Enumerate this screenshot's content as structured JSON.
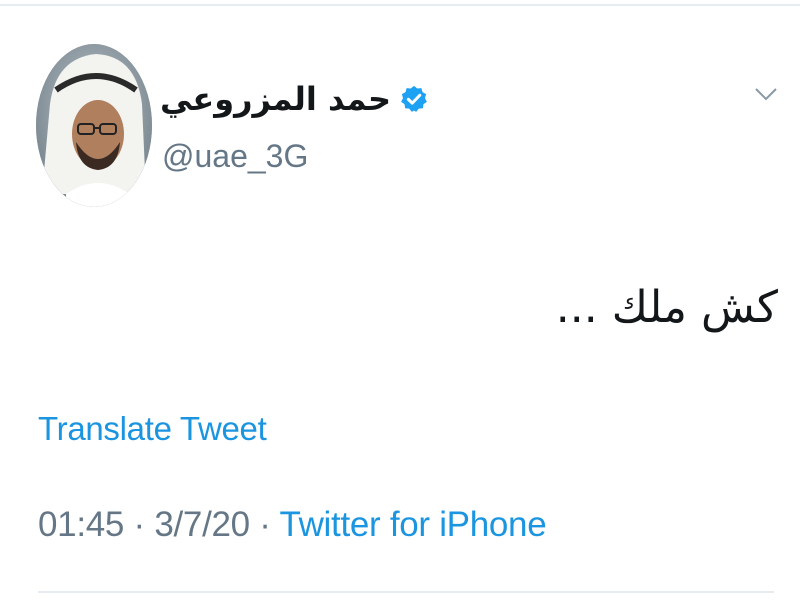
{
  "tweet": {
    "author": {
      "display_name": "حمد المزروعي",
      "handle": "@uae_3G",
      "verified": true
    },
    "text": "كش ملك ...",
    "translate_label": "Translate Tweet",
    "time": "01:45",
    "separator": "·",
    "date": "3/7/20",
    "source": "Twitter for iPhone"
  },
  "icons": {
    "verified": "verified-badge-icon",
    "caret": "chevron-down-icon"
  },
  "colors": {
    "link": "#1b95e0",
    "secondary_text": "#657786",
    "primary_text": "#14171a",
    "verified_badge": "#1da1f2"
  }
}
